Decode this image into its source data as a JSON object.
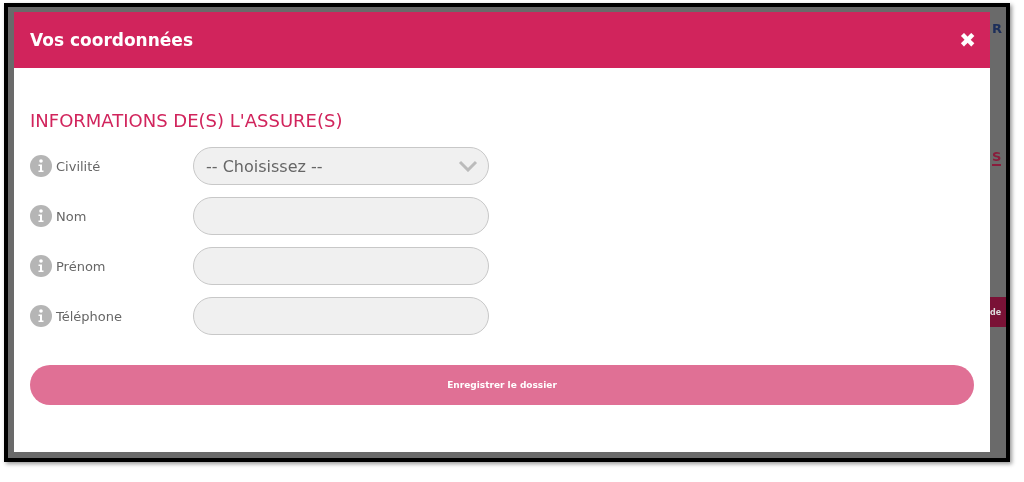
{
  "background": {
    "fragments": [
      {
        "kind": "logo",
        "text": "R"
      },
      {
        "kind": "tab",
        "text": "S"
      },
      {
        "kind": "button",
        "text": "de"
      }
    ]
  },
  "dialog": {
    "title": "Vos coordonnées",
    "close_icon": "✖",
    "section_title": "INFORMATIONS DE(S) L'ASSURE(S)",
    "fields": [
      {
        "label": "Civilité",
        "kind": "select",
        "value": "-- Choisissez --"
      },
      {
        "label": "Nom",
        "kind": "text"
      },
      {
        "label": "Prénom",
        "kind": "text"
      },
      {
        "label": "Téléphone",
        "kind": "text"
      }
    ],
    "submit_button": "Enregistrer le dossier"
  }
}
